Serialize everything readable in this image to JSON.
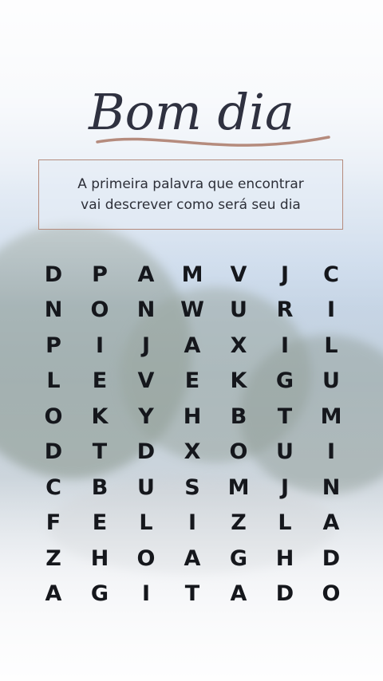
{
  "header": {
    "title": "Bom dia"
  },
  "subtitle": {
    "line1": "A primeira palavra que encontrar",
    "line2": "vai descrever como será seu dia"
  },
  "colors": {
    "accent": "#b58b7d",
    "text": "#15171c",
    "script": "#2f3140"
  },
  "grid": {
    "rows": [
      [
        "D",
        "P",
        "A",
        "M",
        "V",
        "J",
        "C"
      ],
      [
        "N",
        "O",
        "N",
        "W",
        "U",
        "R",
        "I"
      ],
      [
        "P",
        "I",
        "J",
        "A",
        "X",
        "I",
        "L"
      ],
      [
        "L",
        "E",
        "V",
        "E",
        "K",
        "G",
        "U"
      ],
      [
        "O",
        "K",
        "Y",
        "H",
        "B",
        "T",
        "M"
      ],
      [
        "D",
        "T",
        "D",
        "X",
        "O",
        "U",
        "I"
      ],
      [
        "C",
        "B",
        "U",
        "S",
        "M",
        "J",
        "N"
      ],
      [
        "F",
        "E",
        "L",
        "I",
        "Z",
        "L",
        "A"
      ],
      [
        "Z",
        "H",
        "O",
        "A",
        "G",
        "H",
        "D"
      ],
      [
        "A",
        "G",
        "I",
        "T",
        "A",
        "D",
        "O"
      ]
    ]
  }
}
